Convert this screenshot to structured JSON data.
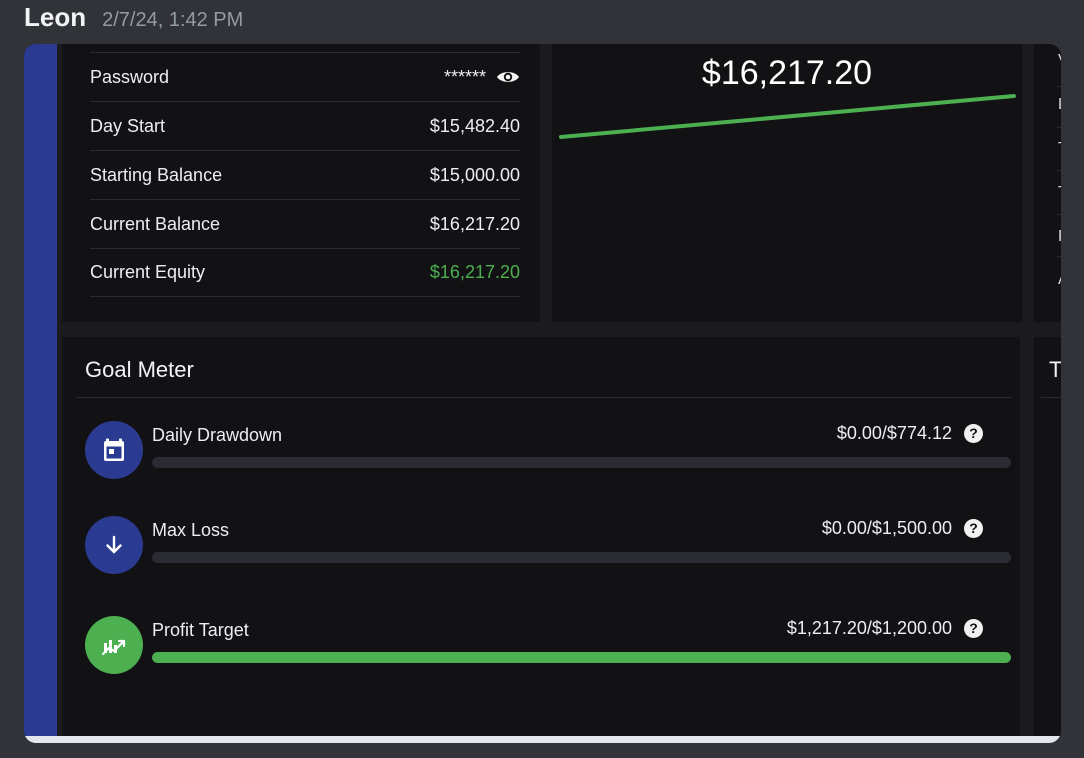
{
  "message": {
    "author": "Leon",
    "timestamp": "2/7/24, 1:42 PM"
  },
  "account": {
    "rows": [
      {
        "label": "Password",
        "value": "******",
        "icon": "eye-icon"
      },
      {
        "label": "Day Start",
        "value": "$15,482.40"
      },
      {
        "label": "Starting Balance",
        "value": "$15,000.00"
      },
      {
        "label": "Current Balance",
        "value": "$16,217.20"
      },
      {
        "label": "Current Equity",
        "value": "$16,217.20",
        "color": "#4caf50"
      }
    ]
  },
  "balance_chart": {
    "amount": "$16,217.20",
    "line_color": "#4caf50"
  },
  "right_panel": {
    "letters": [
      "V",
      "L",
      "T",
      "T",
      "P",
      "A"
    ],
    "goal_card_letter": "T"
  },
  "goal_meter": {
    "title": "Goal Meter",
    "items": [
      {
        "label": "Daily Drawdown",
        "value": "$0.00/$774.12",
        "icon": "calendar-icon",
        "icon_bg": "#2a3b91",
        "progress": 0.0,
        "fill_color": "#4caf50"
      },
      {
        "label": "Max Loss",
        "value": "$0.00/$1,500.00",
        "icon": "arrow-down-icon",
        "icon_bg": "#2a3b91",
        "progress": 0.0,
        "fill_color": "#4caf50"
      },
      {
        "label": "Profit Target",
        "value": "$1,217.20/$1,200.00",
        "icon": "chart-up-icon",
        "icon_bg": "#4caf50",
        "progress": 1.0,
        "fill_color": "#4caf50"
      }
    ],
    "help_glyph": "?"
  }
}
